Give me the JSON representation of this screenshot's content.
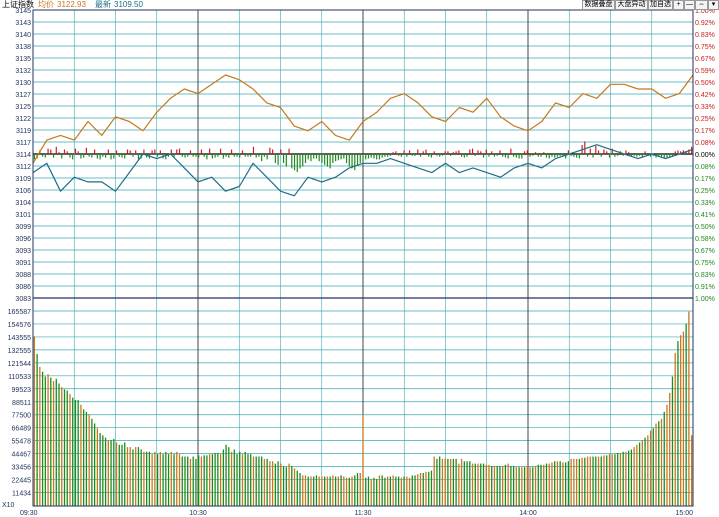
{
  "header": {
    "index_name": "上证指数",
    "avg_label": "均价",
    "avg_value": "3122.93",
    "last_label": "最新",
    "last_value": "3109.50",
    "buttons": [
      "数据叠盘",
      "大盘异动",
      "加自选",
      "+",
      "—",
      "⇔",
      "▾"
    ]
  },
  "colors": {
    "up": "#c8201e",
    "down": "#1e8a1e",
    "avg_line": "#c8781e",
    "price_line": "#1e6e86",
    "grid": "#3aa9b0",
    "frame": "#20355f",
    "axis_text": "#20355f",
    "zero": "#000000"
  },
  "chart_data": {
    "type": "line",
    "ylim": [
      3083,
      3145
    ],
    "prev_close": 3114,
    "price_ticks": [
      "3145",
      "3143",
      "3140",
      "3138",
      "3135",
      "3132",
      "3130",
      "3127",
      "3125",
      "3122",
      "3119",
      "3117",
      "3114",
      "3112",
      "3109",
      "3106",
      "3104",
      "3101",
      "3099",
      "3096",
      "3093",
      "3091",
      "3088",
      "3086",
      "3083"
    ],
    "pct_ticks": [
      "1.00%",
      "0.92%",
      "0.83%",
      "0.75%",
      "0.67%",
      "0.59%",
      "0.50%",
      "0.42%",
      "0.33%",
      "0.25%",
      "0.17%",
      "0.08%",
      "0.00%",
      "0.08%",
      "0.17%",
      "0.25%",
      "0.33%",
      "0.41%",
      "0.50%",
      "0.58%",
      "0.67%",
      "0.75%",
      "0.83%",
      "0.91%",
      "1.00%"
    ],
    "volume_ticks": [
      "165587",
      "154576",
      "143555",
      "132555",
      "121544",
      "110533",
      "99523",
      "88511",
      "77500",
      "66489",
      "55478",
      "44467",
      "33456",
      "22445",
      "11434"
    ],
    "volume_unit": "X10",
    "volume_max": 176598,
    "time_labels": [
      "09:30",
      "10:30",
      "11:30",
      "14:00",
      "15:00"
    ],
    "series": [
      {
        "name": "均价",
        "x": [
          0,
          5,
          10,
          15,
          20,
          25,
          30,
          35,
          40,
          45,
          50,
          55,
          60,
          65,
          70,
          75,
          80,
          85,
          90,
          95,
          100,
          105,
          110,
          115,
          120,
          125,
          130,
          135,
          140,
          145,
          150,
          155,
          160,
          165,
          170,
          175,
          180,
          185,
          190,
          195,
          200,
          205,
          210,
          215,
          220,
          225,
          230,
          235,
          240
        ],
        "values": [
          3112,
          3117,
          3118,
          3117,
          3121,
          3118,
          3122,
          3121,
          3119,
          3123,
          3126,
          3128,
          3127,
          3129,
          3131,
          3130,
          3128,
          3125,
          3124,
          3120,
          3119,
          3121,
          3118,
          3117,
          3121,
          3123,
          3126,
          3127,
          3125,
          3122,
          3121,
          3124,
          3123,
          3126,
          3122,
          3120,
          3119,
          3121,
          3125,
          3124,
          3127,
          3126,
          3129,
          3129,
          3128,
          3128,
          3126,
          3127,
          3131
        ]
      },
      {
        "name": "最新",
        "x": [
          0,
          5,
          10,
          15,
          20,
          25,
          30,
          35,
          40,
          45,
          50,
          55,
          60,
          65,
          70,
          75,
          80,
          85,
          90,
          95,
          100,
          105,
          110,
          115,
          120,
          125,
          130,
          135,
          140,
          145,
          150,
          155,
          160,
          165,
          170,
          175,
          180,
          185,
          190,
          195,
          200,
          205,
          210,
          215,
          220,
          225,
          230,
          235,
          240
        ],
        "values": [
          3110,
          3112,
          3106,
          3109,
          3108,
          3108,
          3106,
          3110,
          3114,
          3113,
          3114,
          3111,
          3108,
          3109,
          3106,
          3107,
          3112,
          3109,
          3106,
          3105,
          3109,
          3108,
          3109,
          3111,
          3112,
          3112,
          3113,
          3112,
          3111,
          3110,
          3112,
          3110,
          3111,
          3110,
          3109,
          3111,
          3112,
          3111,
          3113,
          3114,
          3115,
          3116,
          3115,
          3114,
          3113,
          3114,
          3113,
          3114,
          3115
        ]
      }
    ],
    "volume": [
      144000,
      129000,
      118000,
      114000,
      110000,
      112000,
      109000,
      106000,
      108000,
      104000,
      101000,
      99000,
      98000,
      95000,
      92000,
      90000,
      90000,
      86000,
      82000,
      80000,
      78000,
      74000,
      70000,
      66000,
      62000,
      60000,
      58000,
      56000,
      56000,
      57000,
      54000,
      52000,
      52000,
      54000,
      50000,
      50000,
      48000,
      50000,
      50000,
      48000,
      46000,
      46000,
      46000,
      44000,
      46000,
      44000,
      46000,
      44000,
      46000,
      44000,
      46000,
      44000,
      46000,
      44000,
      42000,
      42000,
      42000,
      40000,
      42000,
      40000,
      43000,
      42000,
      43000,
      43000,
      44000,
      44000,
      45000,
      45000,
      44000,
      48000,
      52000,
      50000,
      46000,
      48000,
      44000,
      46000,
      44000,
      46000,
      44000,
      44000,
      42000,
      42000,
      42000,
      42000,
      40000,
      40000,
      38000,
      38000,
      36000,
      38000,
      36000,
      34000,
      33000,
      36000,
      34000,
      32000,
      30000,
      28000,
      26000,
      26000,
      25000,
      25000,
      25000,
      26000,
      25000,
      25000,
      25000,
      25000,
      25000,
      26000,
      25000,
      25000,
      26000,
      25000,
      24000,
      24000,
      25000,
      26000,
      28000,
      28000,
      78000,
      24000,
      25000,
      23000,
      24000,
      23000,
      26000,
      26000,
      24000,
      25000,
      25000,
      26000,
      25000,
      25000,
      24000,
      25000,
      25000,
      24000,
      26000,
      26000,
      27000,
      28000,
      28000,
      29000,
      29000,
      30000,
      42000,
      40000,
      42000,
      40000,
      40000,
      40000,
      40000,
      40000,
      40000,
      36000,
      40000,
      38000,
      38000,
      38000,
      36000,
      36000,
      36000,
      36000,
      36000,
      35000,
      35000,
      34000,
      34000,
      34000,
      34000,
      34000,
      35000,
      36000,
      34000,
      34000,
      33000,
      33000,
      33000,
      33000,
      34000,
      33000,
      33000,
      34000,
      35000,
      35000,
      35000,
      36000,
      36000,
      37000,
      38000,
      38000,
      38000,
      37000,
      37000,
      38000,
      40000,
      40000,
      40000,
      40000,
      41000,
      41000,
      42000,
      42000,
      42000,
      42000,
      42000,
      42000,
      43000,
      43000,
      44000,
      44000,
      44000,
      45000,
      45000,
      46000,
      46000,
      47000,
      48000,
      50000,
      52000,
      54000,
      56000,
      58000,
      60000,
      64000,
      66000,
      70000,
      72000,
      74000,
      80000,
      86000,
      96000,
      110000,
      130000,
      140000,
      145000,
      148000,
      155000,
      165000,
      60000
    ],
    "volume_up": [
      1,
      0,
      1,
      0,
      0,
      1,
      0,
      1,
      0,
      0,
      1,
      0,
      0,
      1,
      0,
      0,
      0,
      1,
      0,
      0,
      1,
      0,
      0,
      1,
      0,
      0,
      0,
      1,
      0,
      0,
      1,
      0,
      0,
      0,
      1,
      1,
      0,
      1,
      0,
      0,
      1,
      0,
      0,
      1,
      1,
      0,
      1,
      0,
      0,
      0,
      1,
      0,
      1,
      1,
      0,
      0,
      0,
      1,
      0,
      0,
      0,
      1,
      0,
      0,
      1,
      0,
      0,
      0,
      1,
      0,
      0,
      0,
      1,
      0,
      0,
      0,
      1,
      0,
      0,
      0,
      1,
      0,
      0,
      0,
      1,
      0,
      1,
      1,
      0,
      0,
      1,
      0,
      0,
      1,
      0,
      1,
      0,
      0,
      1,
      1,
      0,
      1,
      0,
      0,
      1,
      1,
      0,
      1,
      0,
      1,
      0,
      1,
      0,
      1,
      1,
      0,
      1,
      0,
      0,
      1,
      1,
      0,
      0,
      1,
      0,
      0,
      1,
      0,
      0,
      1,
      0,
      1,
      0,
      0,
      1,
      0,
      1,
      1,
      0,
      0,
      1,
      1,
      0,
      1,
      0,
      0,
      1,
      0,
      0,
      1,
      1,
      0,
      1,
      0,
      0,
      1,
      1,
      0,
      0,
      0,
      1,
      0,
      1,
      0,
      0,
      1,
      1,
      0,
      1,
      0,
      0,
      1,
      0,
      1,
      0,
      0,
      1,
      0,
      1,
      0,
      1,
      1,
      0,
      1,
      0,
      0,
      1,
      0,
      1,
      1,
      0,
      1,
      0,
      1,
      0,
      0,
      1,
      1,
      1,
      0,
      1,
      0,
      1,
      1,
      0,
      0,
      1,
      0,
      1,
      0,
      1,
      1,
      0,
      0,
      1,
      0,
      1,
      0,
      0,
      1,
      1,
      0,
      1,
      0,
      1,
      1,
      0,
      1,
      0,
      1,
      0,
      1,
      1,
      0,
      1,
      0,
      1,
      1,
      0,
      1,
      1
    ],
    "change": [
      -6,
      -5,
      4,
      -3,
      -4,
      6,
      5,
      -4,
      8,
      2,
      -5,
      5,
      3,
      -4,
      -6,
      6,
      3,
      -5,
      -4,
      7,
      -3,
      -4,
      5,
      -5,
      -6,
      -3,
      -4,
      5,
      -6,
      -5,
      4,
      -3,
      -4,
      -5,
      5,
      4,
      -3,
      4,
      -6,
      -5,
      5,
      -4,
      -5,
      4,
      5,
      -3,
      4,
      -5,
      -6,
      -3,
      5,
      -4,
      5,
      6,
      -3,
      -4,
      -3,
      4,
      -3,
      -3,
      -4,
      5,
      -3,
      -6,
      6,
      -5,
      -4,
      -3,
      6,
      -5,
      -3,
      -4,
      5,
      -3,
      -3,
      -4,
      4,
      -3,
      -3,
      -3,
      8,
      -4,
      -3,
      -8,
      -3,
      -6,
      7,
      5,
      -10,
      -12,
      5,
      -10,
      -14,
      6,
      -16,
      -18,
      -20,
      -16,
      -14,
      -10,
      -6,
      -8,
      -5,
      -5,
      -8,
      -10,
      -12,
      -14,
      -16,
      -10,
      -8,
      -7,
      -6,
      -5,
      -10,
      -14,
      -16,
      -18,
      -12,
      -10,
      -8,
      -6,
      -5,
      -4,
      -5,
      -6,
      -6,
      -4,
      -3,
      -3,
      -2,
      2,
      3,
      -2,
      -3,
      4,
      -3,
      4,
      -2,
      -2,
      5,
      -3,
      3,
      5,
      -3,
      -4,
      3,
      -2,
      -3,
      -2,
      3,
      3,
      -2,
      2,
      3,
      4,
      -3,
      -4,
      -3,
      5,
      6,
      -2,
      4,
      3,
      -4,
      5,
      -3,
      3,
      -3,
      -2,
      4,
      -3,
      -4,
      -5,
      6,
      -3,
      -4,
      -5,
      -5,
      3,
      4,
      -3,
      -2,
      2,
      -3,
      -3,
      2,
      -4,
      -5,
      -3,
      -4,
      -3,
      -2,
      -3,
      -5,
      4,
      -2,
      -3,
      -4,
      -5,
      10,
      14,
      -3,
      6,
      -4,
      9,
      4,
      -3,
      5,
      3,
      -4,
      6,
      -3,
      -2,
      3,
      -2,
      4,
      2,
      -3,
      -2,
      -3,
      -2,
      -4,
      3,
      -2,
      -3,
      -2,
      -4,
      -3,
      -3,
      -5,
      -4,
      -3,
      -3,
      3,
      4,
      3,
      4,
      3,
      5,
      8
    ]
  }
}
